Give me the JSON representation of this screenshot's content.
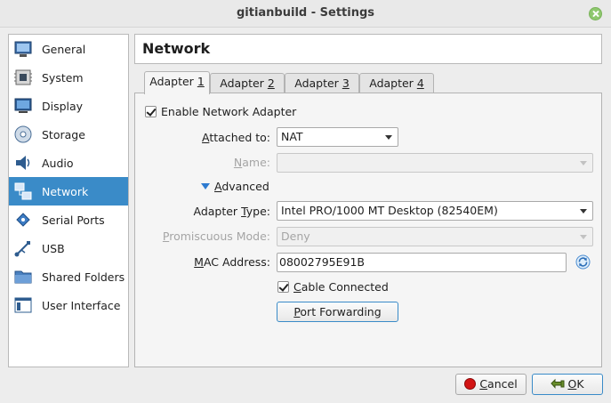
{
  "window": {
    "title": "gitianbuild - Settings",
    "close_icon": "close-icon"
  },
  "sidebar": {
    "items": [
      {
        "label": "General",
        "icon": "general-icon"
      },
      {
        "label": "System",
        "icon": "chip-icon"
      },
      {
        "label": "Display",
        "icon": "monitor-icon"
      },
      {
        "label": "Storage",
        "icon": "disk-icon"
      },
      {
        "label": "Audio",
        "icon": "speaker-icon"
      },
      {
        "label": "Network",
        "icon": "network-icon",
        "active": true
      },
      {
        "label": "Serial Ports",
        "icon": "serial-port-icon"
      },
      {
        "label": "USB",
        "icon": "usb-icon"
      },
      {
        "label": "Shared Folders",
        "icon": "folder-icon"
      },
      {
        "label": "User Interface",
        "icon": "user-interface-icon"
      }
    ]
  },
  "page": {
    "title": "Network"
  },
  "tabs": [
    {
      "label": "Adapter ",
      "accel": "1",
      "active": true
    },
    {
      "label": "Adapter ",
      "accel": "2"
    },
    {
      "label": "Adapter ",
      "accel": "3"
    },
    {
      "label": "Adapter ",
      "accel": "4"
    }
  ],
  "adapter": {
    "enable_label": "Enable Network Adapter",
    "enable_checked": true,
    "attached_to": {
      "label_accel": "A",
      "label_rest": "ttached to:",
      "value": "NAT"
    },
    "name": {
      "label_accel": "N",
      "label_rest": "ame:",
      "value": ""
    },
    "advanced": {
      "label_accel": "A",
      "label_rest": "dvanced",
      "expanded": true
    },
    "adapter_type": {
      "label_pre": "Adapter ",
      "label_accel": "T",
      "label_rest": "ype:",
      "value": "Intel PRO/1000 MT Desktop (82540EM)"
    },
    "promiscuous": {
      "label_accel": "P",
      "label_rest": "romiscuous Mode:",
      "value": "Deny"
    },
    "mac": {
      "label_accel": "M",
      "label_rest": "AC Address:",
      "value": "08002795E91B",
      "refresh_icon": "refresh-icon"
    },
    "cable": {
      "label_accel": "C",
      "label_rest": "able Connected",
      "checked": true
    },
    "port_forwarding": {
      "label_accel": "P",
      "label_rest": "ort Forwarding"
    }
  },
  "footer": {
    "cancel": {
      "label_accel": "C",
      "label_rest": "ancel",
      "icon": "cancel-icon"
    },
    "ok": {
      "label_accel": "O",
      "label_rest": "K",
      "icon": "ok-icon"
    }
  }
}
